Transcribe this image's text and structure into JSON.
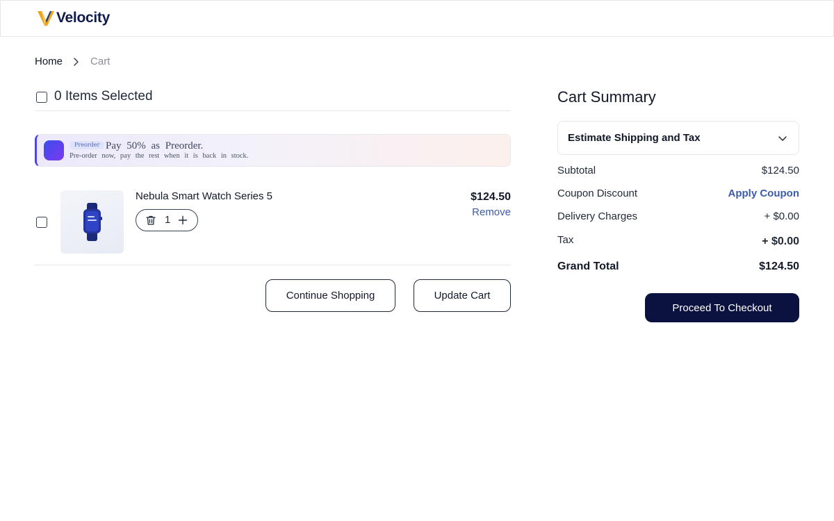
{
  "brand": {
    "name": "Velocity",
    "accent": "#f0a71b",
    "navy": "#0f1b4c"
  },
  "breadcrumb": {
    "home": "Home",
    "current": "Cart"
  },
  "selection": {
    "label": "0 Items Selected"
  },
  "preorder_banner": {
    "tag": "Preorder",
    "title": "Pay 50% as Preorder.",
    "subtitle": "Pre-order now, pay the rest when it is back in stock."
  },
  "cart_items": [
    {
      "name": "Nebula Smart Watch Series 5",
      "quantity": "1",
      "price": "$124.50",
      "remove_label": "Remove",
      "icons": [
        "trash-icon",
        "plus-icon"
      ]
    }
  ],
  "actions": {
    "continue_label": "Continue Shopping",
    "update_label": "Update Cart"
  },
  "summary": {
    "title": "Cart Summary",
    "estimate_label": "Estimate Shipping and Tax",
    "subtotal_label": "Subtotal",
    "subtotal_value": "$124.50",
    "coupon_label": "Coupon Discount",
    "coupon_action": "Apply Coupon",
    "delivery_label": "Delivery Charges",
    "delivery_value": "+ $0.00",
    "tax_label": "Tax",
    "tax_value": "+ $0.00",
    "grand_label": "Grand Total",
    "grand_value": "$124.50",
    "checkout_label": "Proceed To Checkout"
  },
  "colors": {
    "link": "#3b5bab",
    "checkout_bg": "#0b1240",
    "banner_accent": "#4f46e5"
  }
}
